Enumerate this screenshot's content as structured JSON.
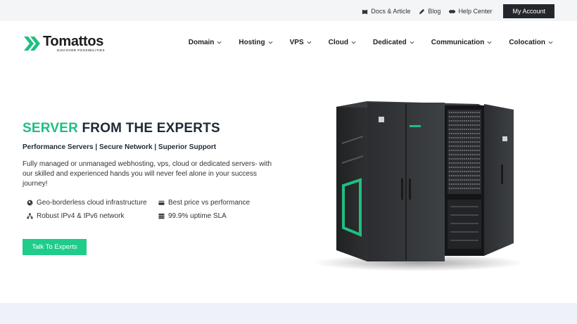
{
  "topbar": {
    "links": [
      {
        "label": "Docs & Article",
        "icon": "book-icon"
      },
      {
        "label": "Blog",
        "icon": "pencil-icon"
      },
      {
        "label": "Help Center",
        "icon": "handshake-icon"
      }
    ],
    "account_label": "My Account"
  },
  "brand": {
    "name": "Tomattos",
    "tagline": "DISCOVER POSSIBILITIES",
    "color": "#1fbf82"
  },
  "nav": {
    "items": [
      {
        "label": "Domain"
      },
      {
        "label": "Hosting"
      },
      {
        "label": "VPS"
      },
      {
        "label": "Cloud"
      },
      {
        "label": "Dedicated"
      },
      {
        "label": "Communication"
      },
      {
        "label": "Colocation"
      }
    ]
  },
  "hero": {
    "title_accent": "SERVER",
    "title_rest": " FROM THE EXPERTS",
    "subtitle": "Performance Servers | Secure Network | Superior Support",
    "description": "Fully managed or unmanaged webhosting, vps, cloud or dedicated servers- with our skilled and experienced hands you will never feel alone in your success journey!",
    "features": [
      {
        "label": "Geo-borderless cloud infrastructure",
        "icon": "globe-icon"
      },
      {
        "label": "Best price vs performance",
        "icon": "credit-card-icon"
      },
      {
        "label": "Robust IPv4 & IPv6 network",
        "icon": "network-icon"
      },
      {
        "label": "99.9% uptime SLA",
        "icon": "server-icon"
      }
    ],
    "cta_label": "Talk To Experts",
    "cta_color": "#1fcc8a"
  }
}
